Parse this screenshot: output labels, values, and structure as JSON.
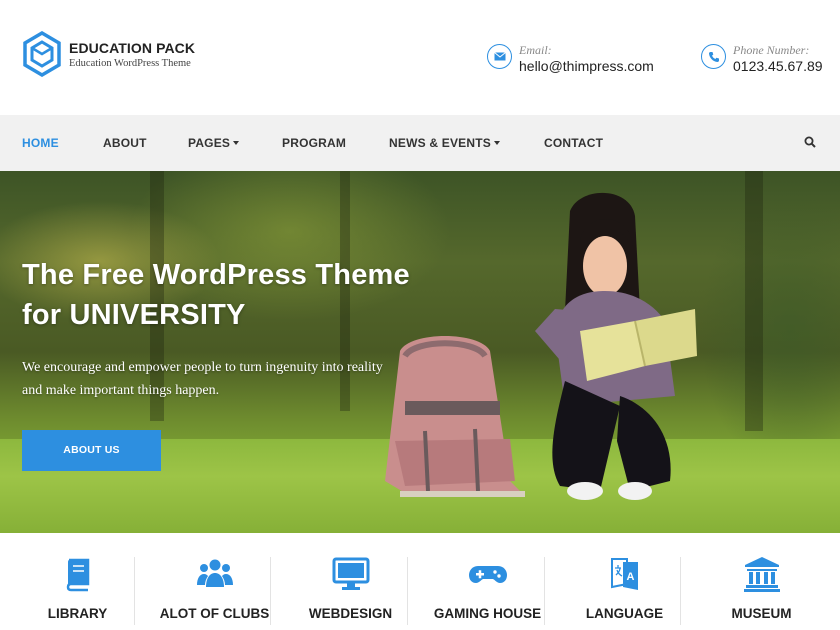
{
  "brand": {
    "name": "EDUCATION PACK",
    "tagline": "Education WordPress Theme"
  },
  "contact": {
    "email_label": "Email:",
    "email_value": "hello@thimpress.com",
    "phone_label": "Phone Number:",
    "phone_value": "0123.45.67.89"
  },
  "nav": {
    "items": [
      {
        "label": "HOME",
        "active": true
      },
      {
        "label": "ABOUT"
      },
      {
        "label": "PAGES",
        "dropdown": true
      },
      {
        "label": "PROGRAM"
      },
      {
        "label": "NEWS & EVENTS",
        "dropdown": true
      },
      {
        "label": "CONTACT"
      }
    ],
    "search_icon": "search-icon"
  },
  "hero": {
    "title_line1": "The Free WordPress Theme",
    "title_line2": "for UNIVERSITY",
    "subtitle_line1": "We encourage and empower people to turn ingenuity into reality",
    "subtitle_line2": "and make important things happen.",
    "cta_label": "ABOUT US"
  },
  "features": [
    {
      "label": "LIBRARY",
      "icon": "book-icon"
    },
    {
      "label": "ALOT OF CLUBS",
      "icon": "users-icon"
    },
    {
      "label": "WEBDESIGN",
      "icon": "monitor-icon"
    },
    {
      "label": "GAMING HOUSE",
      "icon": "gamepad-icon"
    },
    {
      "label": "LANGUAGE",
      "icon": "language-icon"
    },
    {
      "label": "MUSEUM",
      "icon": "museum-icon"
    }
  ],
  "colors": {
    "accent": "#2d8fe0",
    "nav_bg": "#f1f1f1",
    "text_dark": "#222222"
  }
}
